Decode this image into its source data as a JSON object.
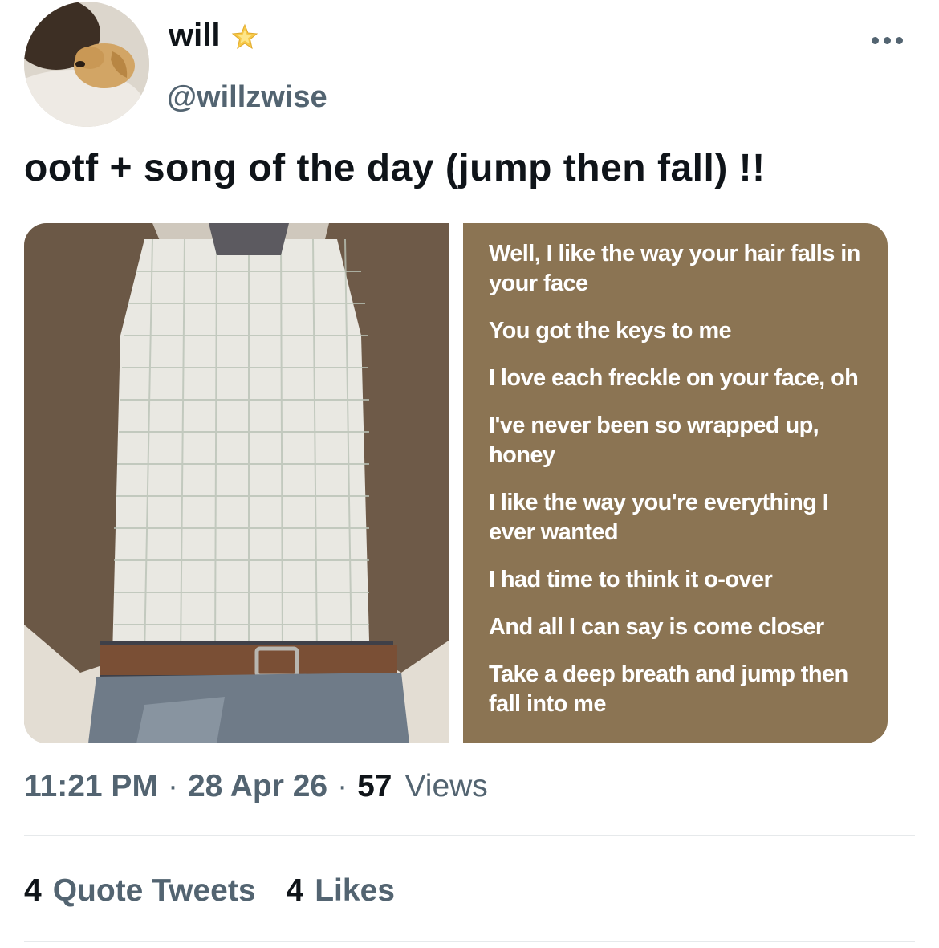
{
  "author": {
    "display_name": "will",
    "badge_icon": "glowing-star-icon",
    "handle": "@willzwise",
    "avatar_description_icon": "avatar-icon"
  },
  "tweet": {
    "text": "ootf + song of the day (jump then fall) !!",
    "lyrics": [
      "Well, I like the way your hair falls in your face",
      "You got the keys to me",
      "I love each freckle on your face, oh",
      "I've never been so wrapped up, honey",
      "I like the way you're everything I ever wanted",
      "I had time to think it o-over",
      "And all I can say is come closer",
      "Take a deep breath and jump then fall into me"
    ]
  },
  "meta": {
    "time": "11:21 PM",
    "dot": "·",
    "date": "28 Apr 26",
    "views_count": "57",
    "views_label": "Views"
  },
  "stats": {
    "quote_tweets_count": "4",
    "quote_tweets_label": "Quote Tweets",
    "likes_count": "4",
    "likes_label": "Likes"
  },
  "colors": {
    "text_primary": "#0f1419",
    "text_secondary": "#536471",
    "lyrics_card_bg": "#8b7453",
    "divider": "#e6e9eb"
  }
}
